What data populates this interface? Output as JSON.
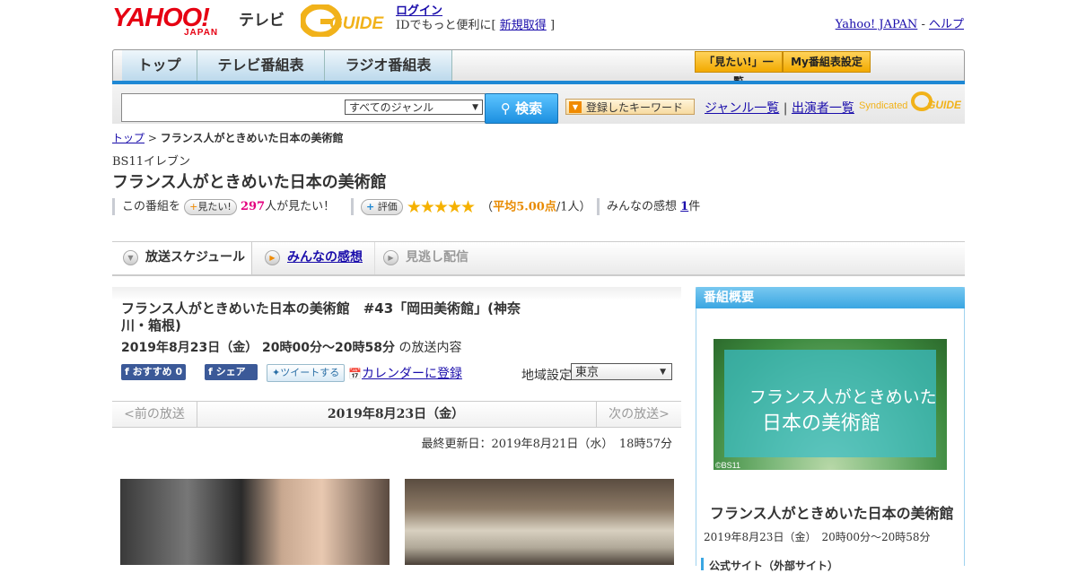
{
  "header": {
    "logo_yahoo": "YAHOO!",
    "logo_japan": "JAPAN",
    "logo_tv": "テレビ",
    "logo_gguide": "G GUIDE",
    "login": "ログイン",
    "login_desc_pre": "IDでもっと便利に[",
    "signup": "新規取得",
    "login_desc_post": "]",
    "yahoo_japan_link": "Yahoo! JAPAN",
    "sep": "-",
    "help_link": "ヘルプ"
  },
  "nav": {
    "tabs": [
      "トップ",
      "テレビ番組表",
      "ラジオ番組表"
    ],
    "want_list": "「見たい!」一覧",
    "my_schedule": "My番組表設定"
  },
  "search": {
    "genre_selected": "すべてのジャンル",
    "button": "検索",
    "keyword_button": "登録したキーワード",
    "genre_list": "ジャンル一覧",
    "divider": "|",
    "performer_list": "出演者一覧",
    "syndicated": "Syndicated"
  },
  "breadcrumb": {
    "top": "トップ",
    "sep": ">",
    "current": "フランス人がときめいた日本の美術館"
  },
  "program": {
    "station": "BS11イレブン",
    "title": "フランス人がときめいた日本の美術館",
    "want_pre": "この番組を",
    "want_button": "見たい!",
    "want_count": "297",
    "want_post": "人が見たい！",
    "rating_button": "評価",
    "stars": "★★★★★",
    "rating_open": "（",
    "rating_avg": "平均5.00点",
    "rating_people": "/1人）",
    "impressions_label": "みんなの感想",
    "impressions_count": "1",
    "impressions_unit": "件"
  },
  "tabs": {
    "schedule": "放送スケジュール",
    "impressions": "みんなの感想",
    "missed": "見逃し配信"
  },
  "episode": {
    "title": "フランス人がときめいた日本の美術館　#43「岡田美術館」(神奈川・箱根)",
    "datetime": "2019年8月23日（金）  20時00分～20時58分",
    "datetime_suffix": "の放送内容",
    "fb_recommend": "おすすめ 0",
    "fb_share": "シェア",
    "tweet": "ツイートする",
    "calendar": "カレンダーに登録",
    "region_label": "地域設定",
    "region_selected": "東京",
    "prev": "<前の放送",
    "current_date": "2019年8月23日（金）",
    "next": "次の放送>",
    "updated": "最終更新日：2019年8月21日（水）　18時57分"
  },
  "sidebar": {
    "heading": "番組概要",
    "image_line1": "フランス人がときめいた",
    "image_line2": "日本の美術館",
    "copyright": "©BS11",
    "title": "フランス人がときめいた日本の美術館",
    "datetime": "2019年8月23日（金）　20時00分～20時58分",
    "official_site": "公式サイト（外部サイト）"
  },
  "colors": {
    "accent_blue": "#1e88d4",
    "want_count_color": "#e4007f",
    "rating_color": "#f5b100"
  }
}
